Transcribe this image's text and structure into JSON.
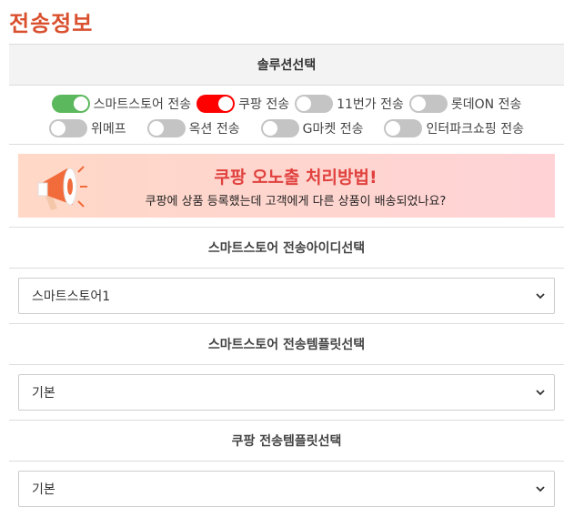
{
  "page": {
    "title": "전송정보"
  },
  "solution": {
    "header": "솔루션선택",
    "rows": [
      [
        {
          "label": "스마트스토어 전송",
          "on": true,
          "color": "#5cb85c"
        },
        {
          "label": "쿠팡 전송",
          "on": true,
          "color": "#ff0000"
        },
        {
          "label": "11번가 전송",
          "on": false
        },
        {
          "label": "롯데ON 전송",
          "on": false
        }
      ],
      [
        {
          "label": "위메프",
          "on": false
        },
        {
          "label": "옥션 전송",
          "on": false
        },
        {
          "label": "G마켓 전송",
          "on": false
        },
        {
          "label": "인터파크쇼핑 전송",
          "on": false
        }
      ]
    ]
  },
  "banner": {
    "title": "쿠팡 오노출 처리방법!",
    "subtitle": "쿠팡에 상품 등록했는데 고객에게 다른 상품이 배송되었나요?"
  },
  "smartstore_id": {
    "header": "스마트스토어 전송아이디선택",
    "value": "스마트스토어1"
  },
  "smartstore_template": {
    "header": "스마트스토어 전송템플릿선택",
    "value": "기본"
  },
  "coupang_template": {
    "header": "쿠팡 전송템플릿선택",
    "value": "기본"
  },
  "colors": {
    "title": "#d9502f",
    "switch_off": "#c4c4c4"
  }
}
